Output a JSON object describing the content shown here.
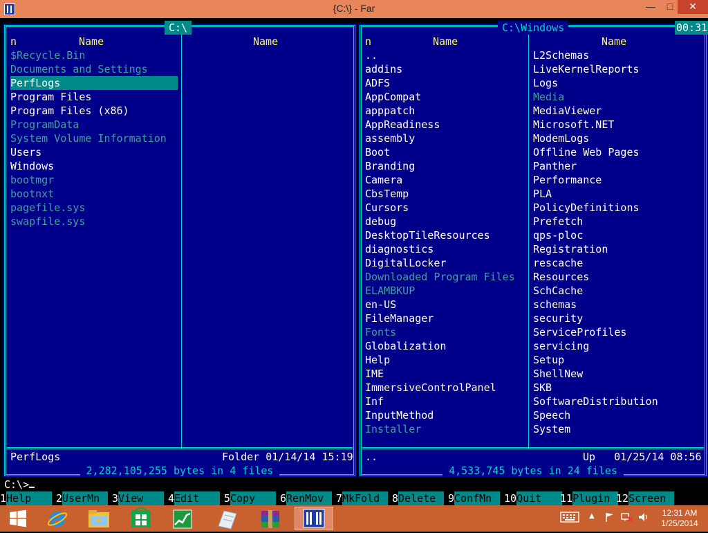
{
  "window": {
    "title": "{C:\\} - Far"
  },
  "left_panel": {
    "path": "C:\\",
    "col1_header_n": "n",
    "col1_header": "Name",
    "col2_header": "Name",
    "selected_name": "PerfLogs",
    "selected_info": "Folder 01/14/14 15:19",
    "summary": " 2,282,105,255 bytes in 4 files ",
    "files": [
      {
        "name": "$Recycle.Bin",
        "style": "dim"
      },
      {
        "name": "Documents and Settings",
        "style": "dim"
      },
      {
        "name": "PerfLogs",
        "style": "sel"
      },
      {
        "name": "Program Files",
        "style": "normal"
      },
      {
        "name": "Program Files (x86)",
        "style": "normal"
      },
      {
        "name": "ProgramData",
        "style": "dim"
      },
      {
        "name": "System Volume Information",
        "style": "dim"
      },
      {
        "name": "Users",
        "style": "normal"
      },
      {
        "name": "Windows",
        "style": "normal"
      },
      {
        "name": "bootmgr",
        "style": "dim"
      },
      {
        "name": "bootnxt",
        "style": "dim"
      },
      {
        "name": "pagefile.sys",
        "style": "dim"
      },
      {
        "name": "swapfile.sys",
        "style": "dim"
      }
    ]
  },
  "right_panel": {
    "path": "C:\\Windows",
    "clock": "00:31",
    "col1_header_n": "n",
    "col1_header": "Name",
    "col2_header": "Name",
    "selected_name": "..",
    "selected_info": "Up   01/25/14 08:56",
    "summary": " 4,533,745 bytes in 24 files ",
    "files_col1": [
      {
        "name": "..",
        "style": "normal"
      },
      {
        "name": "addins",
        "style": "normal"
      },
      {
        "name": "ADFS",
        "style": "normal"
      },
      {
        "name": "AppCompat",
        "style": "normal"
      },
      {
        "name": "apppatch",
        "style": "normal"
      },
      {
        "name": "AppReadiness",
        "style": "normal"
      },
      {
        "name": "assembly",
        "style": "normal"
      },
      {
        "name": "Boot",
        "style": "normal"
      },
      {
        "name": "Branding",
        "style": "normal"
      },
      {
        "name": "Camera",
        "style": "normal"
      },
      {
        "name": "CbsTemp",
        "style": "normal"
      },
      {
        "name": "Cursors",
        "style": "normal"
      },
      {
        "name": "debug",
        "style": "normal"
      },
      {
        "name": "DesktopTileResources",
        "style": "normal"
      },
      {
        "name": "diagnostics",
        "style": "normal"
      },
      {
        "name": "DigitalLocker",
        "style": "normal"
      },
      {
        "name": "Downloaded Program Files",
        "style": "dim"
      },
      {
        "name": "ELAMBKUP",
        "style": "dim"
      },
      {
        "name": "en-US",
        "style": "normal"
      },
      {
        "name": "FileManager",
        "style": "normal"
      },
      {
        "name": "Fonts",
        "style": "dim"
      },
      {
        "name": "Globalization",
        "style": "normal"
      },
      {
        "name": "Help",
        "style": "normal"
      },
      {
        "name": "IME",
        "style": "normal"
      },
      {
        "name": "ImmersiveControlPanel",
        "style": "normal"
      },
      {
        "name": "Inf",
        "style": "normal"
      },
      {
        "name": "InputMethod",
        "style": "normal"
      },
      {
        "name": "Installer",
        "style": "dim"
      }
    ],
    "files_col2": [
      {
        "name": "L2Schemas",
        "style": "normal"
      },
      {
        "name": "LiveKernelReports",
        "style": "normal"
      },
      {
        "name": "Logs",
        "style": "normal"
      },
      {
        "name": "Media",
        "style": "dim"
      },
      {
        "name": "MediaViewer",
        "style": "normal"
      },
      {
        "name": "Microsoft.NET",
        "style": "normal"
      },
      {
        "name": "ModemLogs",
        "style": "normal"
      },
      {
        "name": "Offline Web Pages",
        "style": "normal"
      },
      {
        "name": "Panther",
        "style": "normal"
      },
      {
        "name": "Performance",
        "style": "normal"
      },
      {
        "name": "PLA",
        "style": "normal"
      },
      {
        "name": "PolicyDefinitions",
        "style": "normal"
      },
      {
        "name": "Prefetch",
        "style": "normal"
      },
      {
        "name": "qps-ploc",
        "style": "normal"
      },
      {
        "name": "Registration",
        "style": "normal"
      },
      {
        "name": "rescache",
        "style": "normal"
      },
      {
        "name": "Resources",
        "style": "normal"
      },
      {
        "name": "SchCache",
        "style": "normal"
      },
      {
        "name": "schemas",
        "style": "normal"
      },
      {
        "name": "security",
        "style": "normal"
      },
      {
        "name": "ServiceProfiles",
        "style": "normal"
      },
      {
        "name": "servicing",
        "style": "normal"
      },
      {
        "name": "Setup",
        "style": "normal"
      },
      {
        "name": "ShellNew",
        "style": "normal"
      },
      {
        "name": "SKB",
        "style": "normal"
      },
      {
        "name": "SoftwareDistribution",
        "style": "normal"
      },
      {
        "name": "Speech",
        "style": "normal"
      },
      {
        "name": "System",
        "style": "normal"
      }
    ]
  },
  "command_line": {
    "prompt": "C:\\>"
  },
  "keybar": [
    {
      "num": "1",
      "label": "Help"
    },
    {
      "num": "2",
      "label": "UserMn"
    },
    {
      "num": "3",
      "label": "View"
    },
    {
      "num": "4",
      "label": "Edit"
    },
    {
      "num": "5",
      "label": "Copy"
    },
    {
      "num": "6",
      "label": "RenMov"
    },
    {
      "num": "7",
      "label": "MkFold"
    },
    {
      "num": "8",
      "label": "Delete"
    },
    {
      "num": "9",
      "label": "ConfMn"
    },
    {
      "num": "10",
      "label": "Quit"
    },
    {
      "num": "11",
      "label": "Plugin"
    },
    {
      "num": "12",
      "label": "Screen"
    }
  ],
  "taskbar": {
    "time": "12:31 AM",
    "date": "1/25/2014",
    "icons": [
      "start-icon",
      "internet-explorer-icon",
      "file-explorer-icon",
      "store-icon",
      "task-manager-icon",
      "notepad-icon",
      "winrar-icon",
      "far-manager-icon"
    ]
  },
  "colors": {
    "panel_bg": "#00008b",
    "frame": "#00cfcf",
    "header": "#ffff55",
    "dim": "#3ea09c",
    "selection": "#008a8a",
    "title_bar": "#e9855a",
    "taskbar": "#c9602f"
  }
}
